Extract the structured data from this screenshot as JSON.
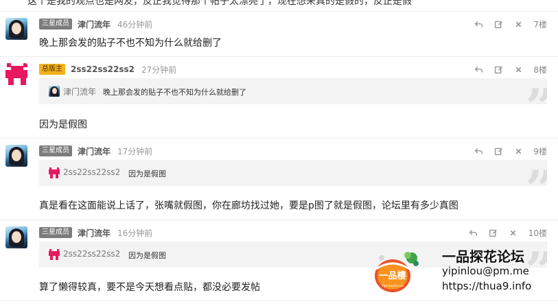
{
  "cut_text": "这个是我的观点也是网友，反正我觉得那个帖子太漂亮了，现在想来真的是假的，反正是假",
  "colors": {
    "badge_member": "#7c7c7c",
    "badge_moderator": "#f3b21b",
    "pixel_avatar": "#e8185f",
    "quote_bg": "#f3f3f4"
  },
  "icons": {
    "reply": "reply-icon",
    "edit": "edit-icon",
    "delete": "close-icon"
  },
  "posts": [
    {
      "badge": "三星成员",
      "username": "津门流年",
      "time": "46分钟前",
      "floor": "7楼",
      "text": "晚上那会发的贴子不也不知为什么就给删了"
    },
    {
      "badge": "总版主",
      "username": "2ss22ss22ss2",
      "time": "27分钟前",
      "floor": "8楼",
      "quote": {
        "name": "津门流年",
        "text": "晚上那会发的贴子不也不知为什么就给删了"
      },
      "text": "因为是假图"
    },
    {
      "badge": "三星成员",
      "username": "津门流年",
      "time": "17分钟前",
      "floor": "9楼",
      "quote": {
        "name": "2ss22ss22ss2",
        "text": "因为是假图"
      },
      "text": "真是看在这面能说上话了，张嘴就假图，你在廊坊找过她，要是p图了就是假图，论坛里有多少真图"
    },
    {
      "badge": "三星成员",
      "username": "津门流年",
      "time": "16分钟前",
      "floor": "10楼",
      "quote": {
        "name": "2ss22ss22ss2",
        "text": "因为是假图"
      },
      "text": "算了懒得较真，要不是今天想看点贴，都没必要发帖"
    }
  ],
  "watermark": {
    "title": "一品探花论坛",
    "email": "yipinlou@pm.me",
    "url": "https://thua9.info",
    "logo_text": "一品樓",
    "logo_subtext": "YipinlouForum"
  }
}
